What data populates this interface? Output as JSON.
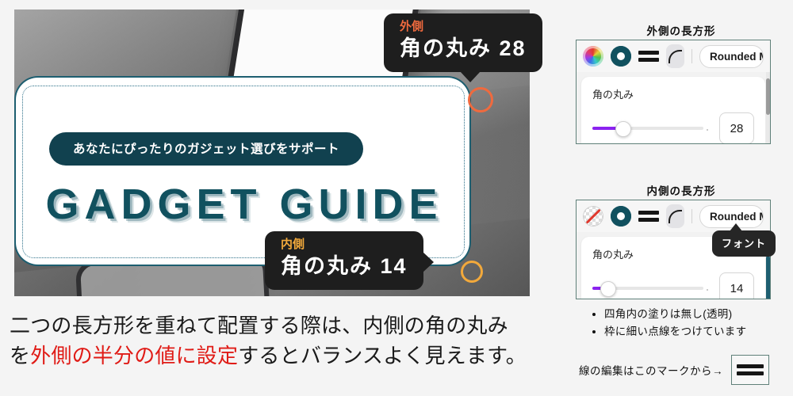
{
  "canvas": {
    "banner": {
      "pill_text": "あなたにぴったりのガジェット選びをサポート",
      "headline": "GADGET GUIDE"
    },
    "callouts": [
      {
        "label": "外側",
        "value": "角の丸み 28",
        "color": "#f06a3e"
      },
      {
        "label": "内側",
        "value": "角の丸み 14",
        "color": "#f2a93b"
      }
    ]
  },
  "caption": {
    "line1": "二つの長方形を重ねて配置する際は、内側の角の丸み",
    "line2_prefix": "を",
    "line2_highlight": "外側の半分の値に設定",
    "line2_suffix": "するとバランスよく見えます。",
    "highlight_color": "#e01b16"
  },
  "panels": [
    {
      "title": "外側の長方形",
      "fill_icon": "color-wheel-icon",
      "font_name": "Rounded M+",
      "slider_label": "角の丸み",
      "value": "28",
      "slider_percent": 26,
      "slider_color": "#8b22f0"
    },
    {
      "title": "内側の長方形",
      "fill_icon": "no-fill-icon",
      "font_name": "Rounded M+",
      "slider_label": "角の丸み",
      "value": "14",
      "slider_percent": 13,
      "slider_color": "#8b22f0",
      "tooltip": "フォント"
    }
  ],
  "notes": [
    "四角内の塗りは無し(透明)",
    "枠に細い点線をつけています"
  ],
  "footer": {
    "text": "線の編集はこのマークから→",
    "icon": "line-style-icon"
  }
}
